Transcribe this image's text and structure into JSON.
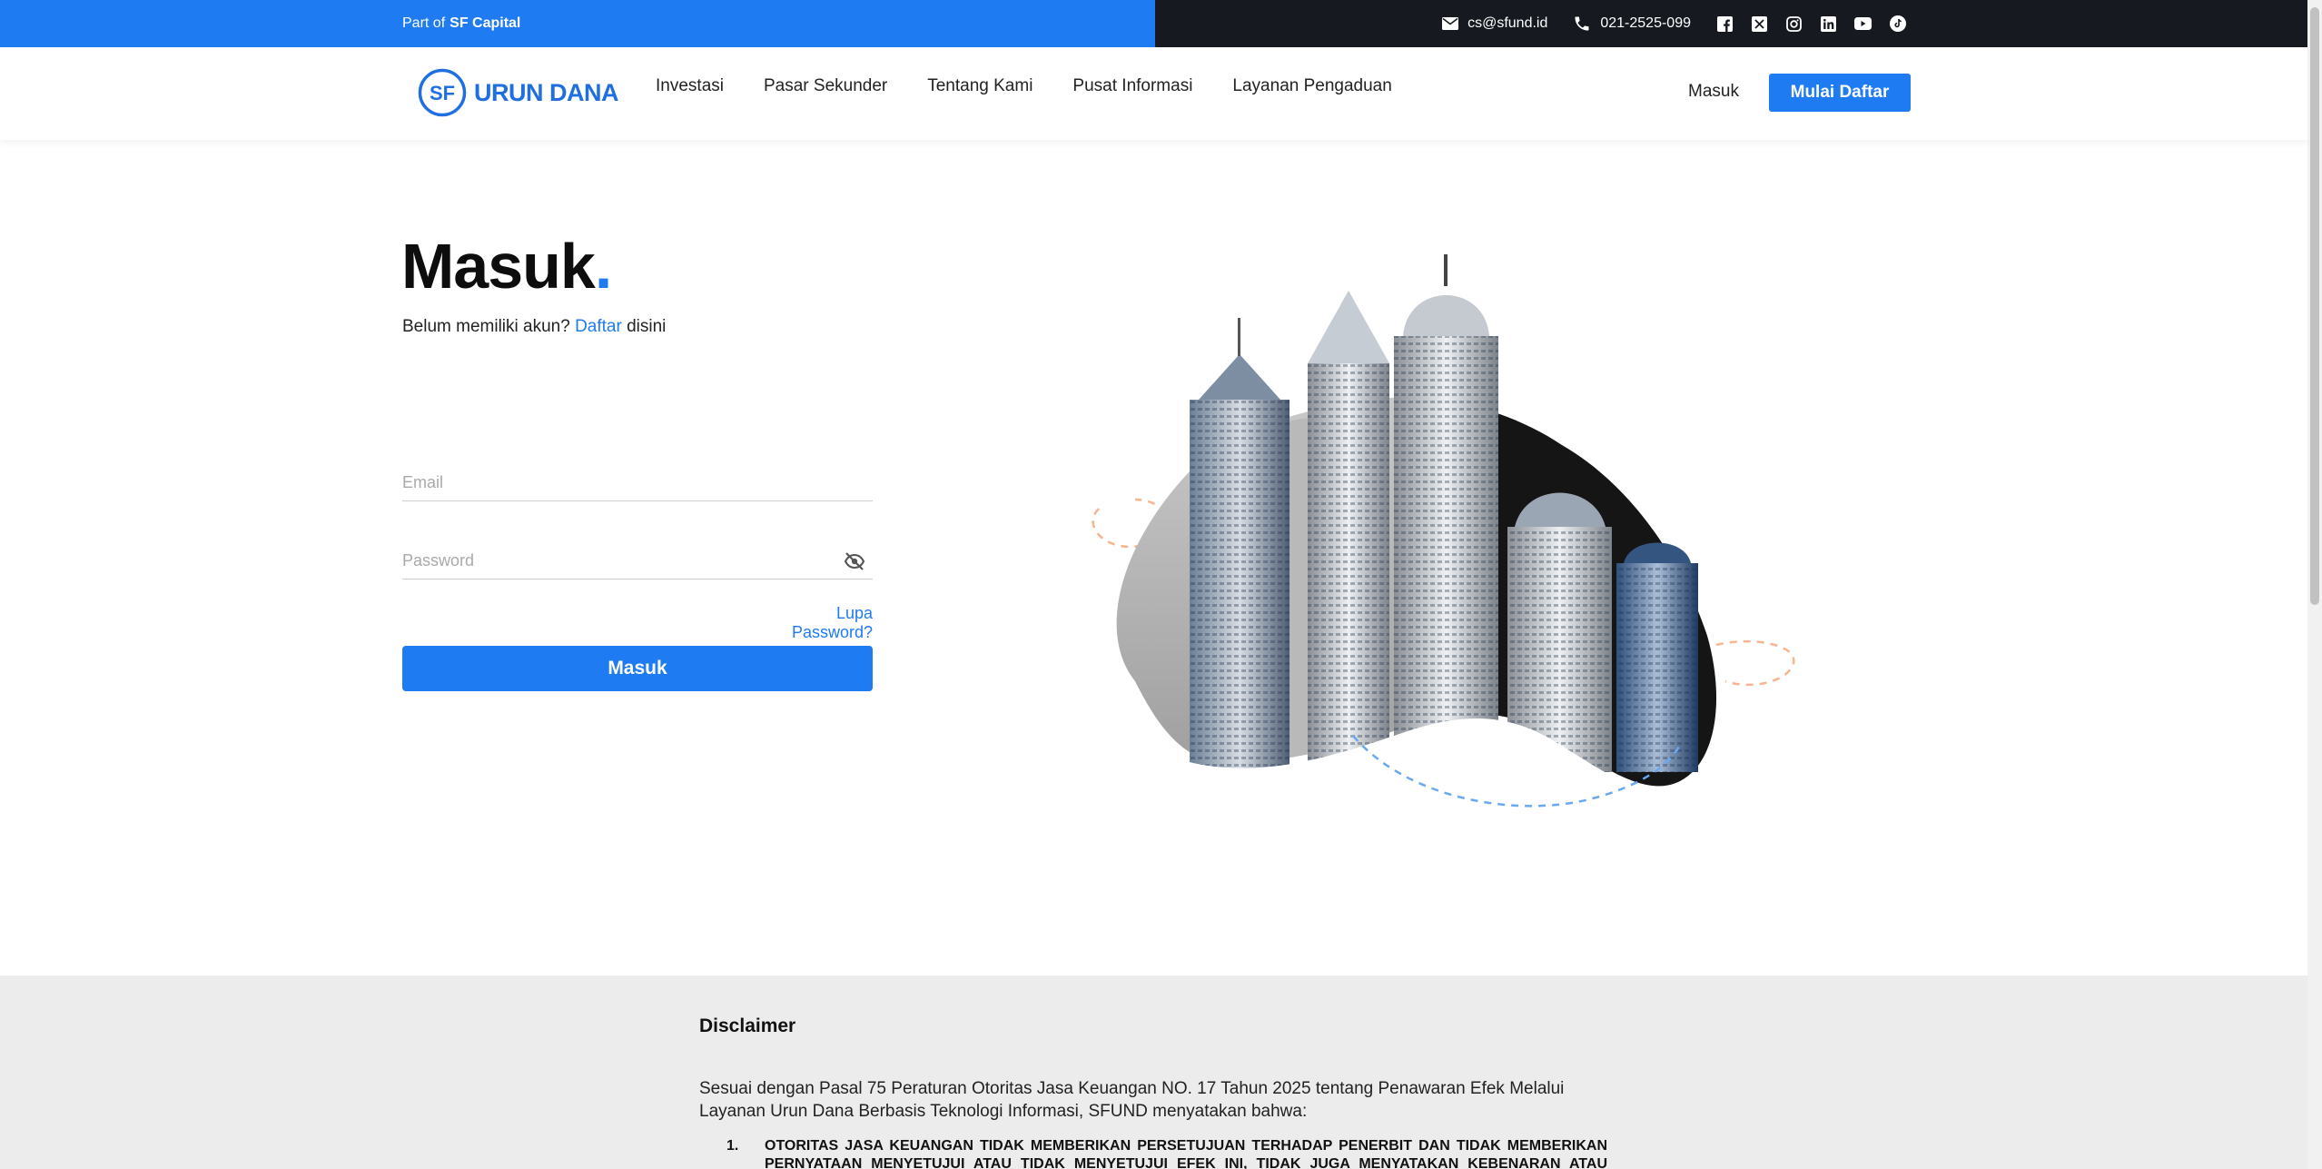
{
  "topbar": {
    "part_of": "Part of",
    "brand": "SF Capital",
    "email": "cs@sfund.id",
    "phone": "021-2525-099",
    "socials": [
      "facebook-icon",
      "x-icon",
      "instagram-icon",
      "linkedin-icon",
      "youtube-icon",
      "tiktok-icon"
    ]
  },
  "header": {
    "logo_text": "URUN DANA",
    "logo_mark": "SF",
    "nav": [
      "Investasi",
      "Pasar Sekunder",
      "Tentang Kami",
      "Pusat Informasi",
      "Layanan Pengaduan"
    ],
    "login_label": "Masuk",
    "register_label": "Mulai Daftar"
  },
  "login": {
    "title": "Masuk",
    "title_dot": ".",
    "signup_prefix": "Belum memiliki akun?",
    "signup_link": "Daftar",
    "signup_suffix": "disini",
    "email_placeholder": "Email",
    "password_placeholder": "Password",
    "forgot_label": "Lupa Password?",
    "submit_label": "Masuk"
  },
  "disclaimer": {
    "title": "Disclaimer",
    "intro": "Sesuai dengan Pasal 75 Peraturan Otoritas Jasa Keuangan NO. 17 Tahun 2025 tentang Penawaran Efek Melalui Layanan Urun Dana Berbasis Teknologi Informasi, SFUND menyatakan bahwa:",
    "item_1_number": "1.",
    "item_1_text": "OTORITAS JASA KEUANGAN TIDAK MEMBERIKAN PERSETUJUAN TERHADAP PENERBIT DAN TIDAK MEMBERIKAN PERNYATAAN MENYETUJUI ATAU TIDAK MENYETUJUI EFEK INI, TIDAK JUGA MENYATAKAN KEBENARAN ATAU KECUKUPAN"
  },
  "colors": {
    "accent": "#1f7bf2",
    "topbar_dark": "#161a20",
    "disclaimer_bg": "#ececec"
  }
}
